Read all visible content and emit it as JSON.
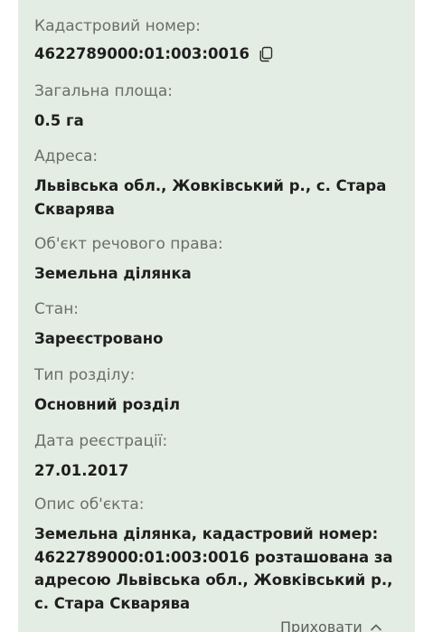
{
  "details": {
    "cadastral_number": {
      "label": "Кадастровий номер:",
      "value": "4622789000:01:003:0016"
    },
    "area": {
      "label": "Загальна площа:",
      "value": "0.5 га"
    },
    "address": {
      "label": "Адреса:",
      "value": "Львівська обл., Жовківський р., с. Стара Скварява"
    },
    "object_type": {
      "label": "Об'єкт речового права:",
      "value": "Земельна ділянка"
    },
    "status": {
      "label": "Стан:",
      "value": "Зареєстровано"
    },
    "section_type": {
      "label": "Тип розділу:",
      "value": "Основний розділ"
    },
    "registration_date": {
      "label": "Дата реєстрації:",
      "value": "27.01.2017"
    },
    "description": {
      "label": "Опис об'єкта:",
      "value": "Земельна ділянка, кадастровий номер: 4622789000:01:003:0016 розташована за адресою Львівська обл., Жовківський р., с. Стара Скварява"
    }
  },
  "collapse_label": "Приховати",
  "icons": {
    "copy": "copy-icon",
    "collapse": "chevron-up-icon"
  },
  "colors": {
    "card_background": "#e4ede4",
    "label": "#6a6e6a",
    "value": "#1f1f1f"
  }
}
